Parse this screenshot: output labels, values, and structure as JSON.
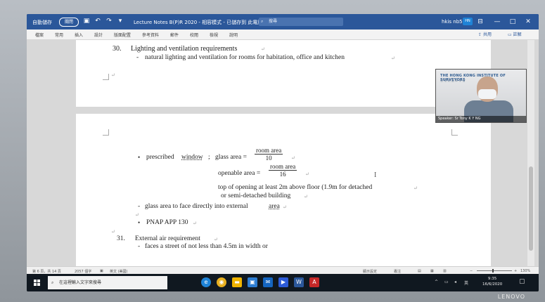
{
  "titlebar": {
    "autosave_label": "自動儲存",
    "autosave_state": "關閉",
    "doc_title": "Lecture Notes B(P)R 2020 - 相容模式 - 已儲存到 此電腦 ▾",
    "search_placeholder": "搜尋",
    "user": "hkis nb55",
    "avatar_initials": "HN",
    "minimize": "—",
    "maximize": "□",
    "close": "✕"
  },
  "ribbon": {
    "tabs": [
      "檔案",
      "常用",
      "插入",
      "設計",
      "版面配置",
      "參考資料",
      "郵件",
      "校閱",
      "檢視",
      "說明"
    ],
    "share": "共用",
    "comments": "註解"
  },
  "document": {
    "item30_number": "30.",
    "item30_heading": "Lighting and ventilation requirements",
    "item30_bullet": "natural lighting and ventilation for rooms for habitation, office and kitchen",
    "prescribed_prefix": "prescribed",
    "prescribed_window": "window",
    "prescribed_sep": ";",
    "glass_area_label": "glass area =",
    "frac1_num": "room area",
    "frac1_den": "10",
    "openable_label": "openable area =",
    "frac2_num": "room area",
    "frac2_den": "16",
    "top_opening": "top of opening at least 2m above floor (1.9m for detached",
    "semi_detached": "or semi-detached building",
    "glass_face_prefix": "glass area to face directly into external",
    "glass_face_area": "area",
    "pnap": "PNAP APP 130",
    "item31_number": "31.",
    "item31_heading": "External air requirement",
    "item31_bullet": "faces a street of not less than 4.5m in width or",
    "bullet_dash": "-",
    "bullet_dot": "•",
    "para_mark": "↵",
    "ibeam": "I"
  },
  "video": {
    "logo": "THE HONG KONG INSTITUTE OF SURVEYORS",
    "logo_sub": "香 港 測 量 師 學 會",
    "caption": "Speaker: Sr Tony K Y NG"
  },
  "statusbar": {
    "page": "第 6 頁，共 14 頁",
    "words": "2057 個字",
    "language": "英文 (美國)",
    "focus": "顯示設定",
    "focus2": "專注",
    "zoom": "130%"
  },
  "taskbar": {
    "search_placeholder": "在這裡輸入文字來搜尋",
    "tray_lang": "英",
    "time": "9:35",
    "date": "16/6/2020"
  },
  "brand": "LENOVO"
}
